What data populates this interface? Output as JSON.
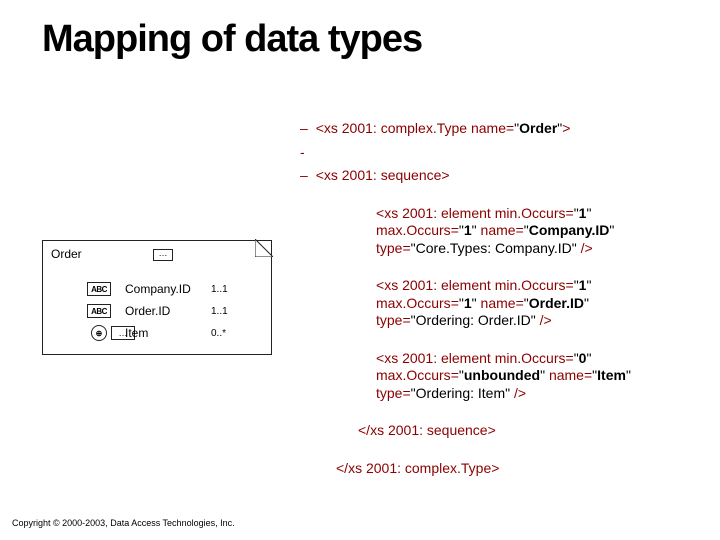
{
  "title": "Mapping of data types",
  "diagram": {
    "root": "Order",
    "rows": [
      {
        "icon": "ABC",
        "name": "Company.ID",
        "card": "1..1"
      },
      {
        "icon": "ABC",
        "name": "Order.ID",
        "card": "1..1"
      },
      {
        "icon": "PLUS",
        "name": "Item",
        "card": "0..*"
      }
    ]
  },
  "xml": {
    "toggle": "–",
    "complexTypeOpen": {
      "tag": "xs 2001: complex.Type",
      "attrName": "name",
      "attrVal": "Order"
    },
    "sequenceOpen": {
      "tag": "xs 2001: sequence"
    },
    "elements": [
      {
        "minLabel": "min.Occurs",
        "min": "1",
        "maxLabel": "max.Occurs",
        "max": "1",
        "nameLabel": "name",
        "name": "Company.ID",
        "typeLabel": "type",
        "type": "Core.Types: Company.ID"
      },
      {
        "minLabel": "min.Occurs",
        "min": "1",
        "maxLabel": "max.Occurs",
        "max": "1",
        "nameLabel": "name",
        "name": "Order.ID",
        "typeLabel": "type",
        "type": "Ordering: Order.ID"
      },
      {
        "minLabel": "min.Occurs",
        "min": "0",
        "maxLabel": "max.Occurs",
        "max": "unbounded",
        "nameLabel": "name",
        "name": "Item",
        "typeLabel": "type",
        "type": "Ordering: Item"
      }
    ],
    "sequenceClose": "</xs 2001: sequence>",
    "complexTypeClose": "</xs 2001: complex.Type>",
    "elementTag": "xs 2001: element"
  },
  "copyright": "Copyright © 2000-2003, Data Access Technologies, Inc."
}
